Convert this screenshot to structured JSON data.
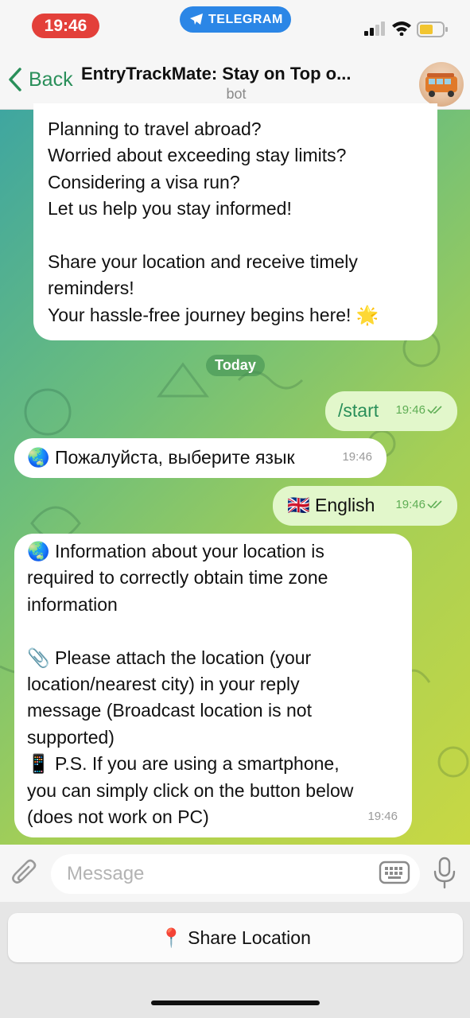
{
  "status_bar": {
    "time": "19:46",
    "app_pill": "TELEGRAM"
  },
  "header": {
    "back_label": "Back",
    "title": "EntryTrackMate: Stay on Top o...",
    "subtitle": "bot"
  },
  "messages": {
    "welcome": {
      "lines": [
        "Planning to travel abroad?",
        "Worried about exceeding stay limits?",
        "Considering a visa run?",
        "Let us help you stay informed!",
        "",
        "Share your location and receive timely",
        "reminders!",
        "Your hassle-free journey begins here! 🌟"
      ]
    },
    "date_badge": "Today",
    "start": {
      "text": "/start",
      "time": "19:46"
    },
    "language_prompt": {
      "text": "🌏 Пожалуйста, выберите язык",
      "time": "19:46"
    },
    "english_choice": {
      "text": "🇬🇧 English",
      "time": "19:46"
    },
    "info": {
      "lines": [
        "🌏 Information about your location is",
        "required to correctly obtain time zone",
        "information",
        "",
        "📎 Please attach the location (your",
        "location/nearest city) in your reply",
        "message (Broadcast location is not",
        "supported)",
        "📱 P.S. If you are using a smartphone,",
        "you can simply click on the button below",
        "(does not work on PC)"
      ],
      "time": "19:46"
    }
  },
  "composer": {
    "placeholder": "Message"
  },
  "keyboard": {
    "share_location_label": "📍 Share Location"
  },
  "colors": {
    "accent_green": "#2a8f5a",
    "outgoing_bubble": "#e2f7cb",
    "time_pill": "#e3403a",
    "telegram_pill": "#2b86e6"
  },
  "icons": [
    "telegram-plane-icon",
    "signal-icon",
    "wifi-icon",
    "battery-icon",
    "chevron-left-icon",
    "paperclip-icon",
    "keyboard-icon",
    "microphone-icon",
    "double-check-icon"
  ]
}
